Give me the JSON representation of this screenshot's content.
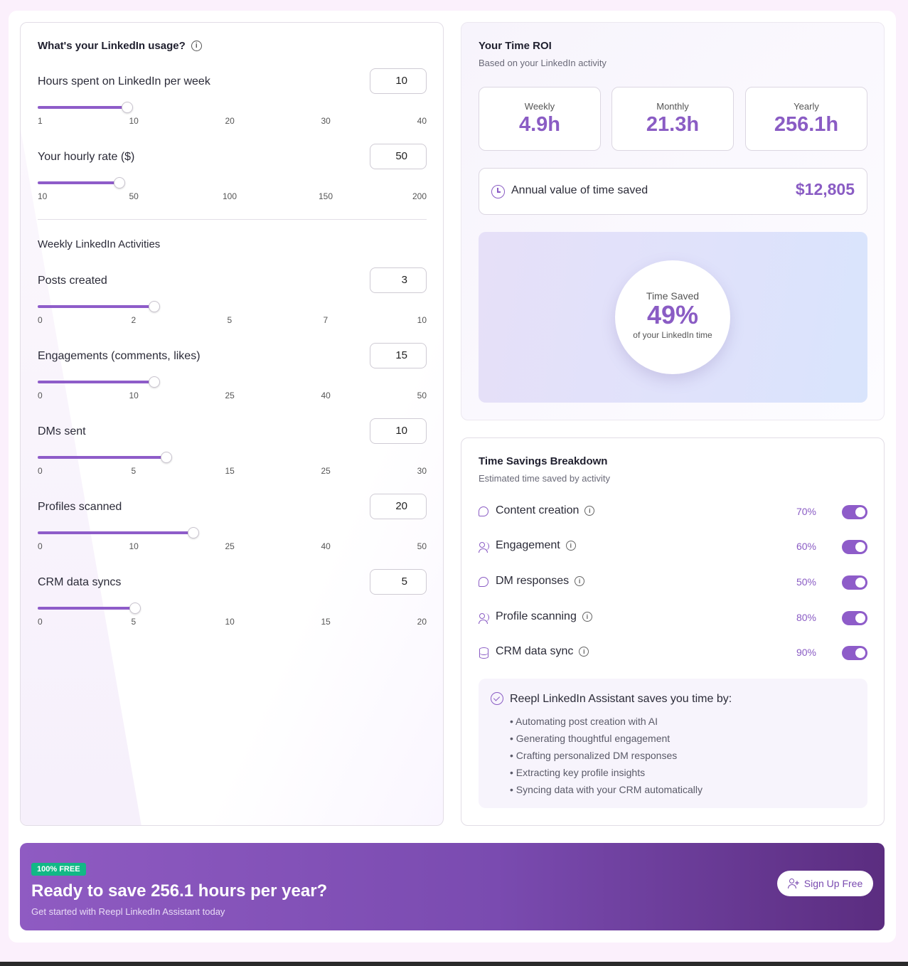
{
  "usage": {
    "title": "What's your LinkedIn usage?",
    "hours": {
      "label": "Hours spent on LinkedIn per week",
      "value": "10",
      "slider_fraction": 0.23,
      "ticks": [
        "1",
        "10",
        "20",
        "30",
        "40"
      ]
    },
    "rate": {
      "label": "Your hourly rate ($)",
      "value": "50",
      "slider_fraction": 0.21,
      "ticks": [
        "10",
        "50",
        "100",
        "150",
        "200"
      ]
    },
    "activities_title": "Weekly LinkedIn Activities",
    "posts": {
      "label": "Posts created",
      "value": "3",
      "slider_fraction": 0.3,
      "ticks": [
        "0",
        "2",
        "5",
        "7",
        "10"
      ]
    },
    "engagements": {
      "label": "Engagements (comments, likes)",
      "value": "15",
      "slider_fraction": 0.3,
      "ticks": [
        "0",
        "10",
        "25",
        "40",
        "50"
      ]
    },
    "dms": {
      "label": "DMs sent",
      "value": "10",
      "slider_fraction": 0.33,
      "ticks": [
        "0",
        "5",
        "15",
        "25",
        "30"
      ]
    },
    "profiles": {
      "label": "Profiles scanned",
      "value": "20",
      "slider_fraction": 0.4,
      "ticks": [
        "0",
        "10",
        "25",
        "40",
        "50"
      ]
    },
    "crm": {
      "label": "CRM data syncs",
      "value": "5",
      "slider_fraction": 0.25,
      "ticks": [
        "0",
        "5",
        "10",
        "15",
        "20"
      ]
    }
  },
  "roi": {
    "title": "Your Time ROI",
    "subtitle": "Based on your LinkedIn activity",
    "weekly": {
      "label": "Weekly",
      "value": "4.9h"
    },
    "monthly": {
      "label": "Monthly",
      "value": "21.3h"
    },
    "yearly": {
      "label": "Yearly",
      "value": "256.1h"
    },
    "annual_label": "Annual value of time saved",
    "annual_value": "$12,805",
    "saved_label": "Time Saved",
    "saved_value": "49%",
    "saved_caption": "of your LinkedIn time"
  },
  "breakdown": {
    "title": "Time Savings Breakdown",
    "subtitle": "Estimated time saved by activity",
    "rows": [
      {
        "name": "Content creation",
        "pct": "70%",
        "icon": "chat-icon",
        "enabled": true
      },
      {
        "name": "Engagement",
        "pct": "60%",
        "icon": "users-icon",
        "enabled": true
      },
      {
        "name": "DM responses",
        "pct": "50%",
        "icon": "chat-icon",
        "enabled": true
      },
      {
        "name": "Profile scanning",
        "pct": "80%",
        "icon": "users-icon",
        "enabled": true
      },
      {
        "name": "CRM data sync",
        "pct": "90%",
        "icon": "database-icon",
        "enabled": true
      }
    ],
    "benefits_title": "Reepl LinkedIn Assistant saves you time by:",
    "benefits": [
      "Automating post creation with AI",
      "Generating thoughtful engagement",
      "Crafting personalized DM responses",
      "Extracting key profile insights",
      "Syncing data with your CRM automatically"
    ]
  },
  "cta": {
    "badge": "100% FREE",
    "title": "Ready to save 256.1 hours per year?",
    "subtitle": "Get started with Reepl LinkedIn Assistant today",
    "button": "Sign Up Free"
  },
  "colors": {
    "accent": "#8a5cc4",
    "slider": "#8e5cc9",
    "badge": "#12b886",
    "page_bg": "#fbf0fc"
  }
}
